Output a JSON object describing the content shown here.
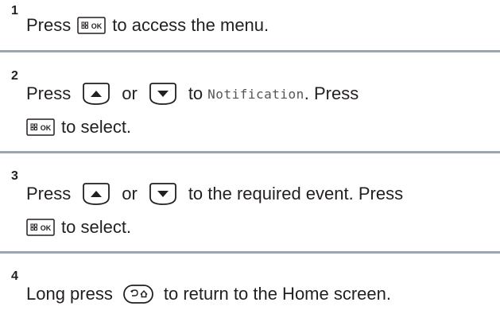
{
  "steps": [
    {
      "number": "1",
      "lines": [
        [
          "Press",
          "",
          "to access the menu."
        ]
      ]
    },
    {
      "number": "2",
      "lines": [
        [
          "Press",
          "or",
          "to",
          "Notification",
          ". Press"
        ],
        [
          "",
          "to select."
        ]
      ]
    },
    {
      "number": "3",
      "lines": [
        [
          "Press",
          "or",
          "to the required event. Press"
        ],
        [
          "",
          "to select."
        ]
      ]
    },
    {
      "number": "4",
      "lines": [
        [
          "Long press",
          "to return to the Home screen."
        ]
      ]
    }
  ],
  "keys": {
    "menu_ok_label": "OK",
    "menu_ok_icon": "menu-ok-key-icon",
    "up_icon": "up-arrow-key-icon",
    "down_icon": "down-arrow-key-icon",
    "back_home_icon": "back-home-key-icon"
  },
  "colors": {
    "text": "#231f20",
    "divider": "#9aa7b2",
    "key_border": "#231f20"
  }
}
